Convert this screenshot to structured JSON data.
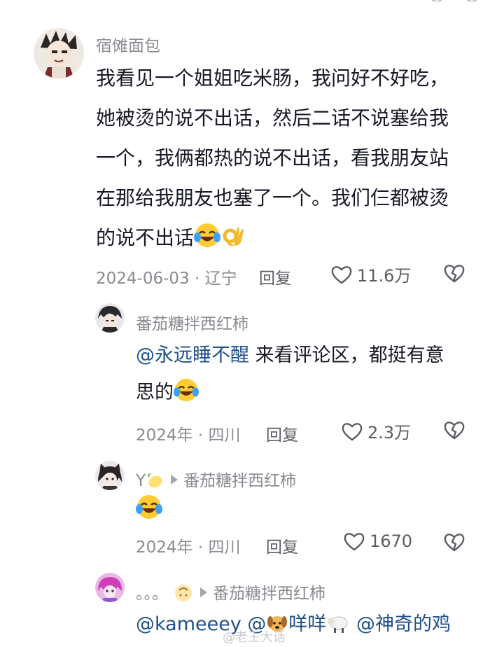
{
  "comments": {
    "main": {
      "username": "宿傩面包",
      "text_lines": [
        "我看见一个姐姐吃米肠，我问好不好吃，",
        "她被烫的说不出话，然后二话不说塞给我",
        "一个，我俩都热的说不出话，看我朋友站",
        "在那给我朋友也塞了一个。我们仨都被烫",
        "的说不出话"
      ],
      "date_location": "2024-06-03 · 辽宁",
      "reply_label": "回复",
      "likes": "11.6万",
      "emojis": [
        "laughing-crying-emoji",
        "ok-hand-emoji"
      ]
    },
    "reply1": {
      "username": "番茄糖拌西红柿",
      "mention": "@永远睡不醒",
      "text_line1": " 来看评论区，都挺有意",
      "text_line2": "思的",
      "date_location": "2024年 · 四川",
      "reply_label": "回复",
      "likes": "2.3万"
    },
    "reply2": {
      "username": "Y",
      "reply_to": "番茄糖拌西红柿",
      "date_location": "2024年 · 四川",
      "reply_label": "回复",
      "likes": "1670"
    },
    "reply3": {
      "username": "。。。",
      "reply_to": "番茄糖拌西红柿",
      "mention1": "@kameeey",
      "mention2_prefix": " @",
      "mention2_name": "咩咩",
      "mention3": " @神奇的鸡"
    }
  },
  "watermark": "@老王大话",
  "colors": {
    "mention": "#1e4f8a",
    "secondary_text": "#8a8b91",
    "primary_text": "#161823"
  }
}
